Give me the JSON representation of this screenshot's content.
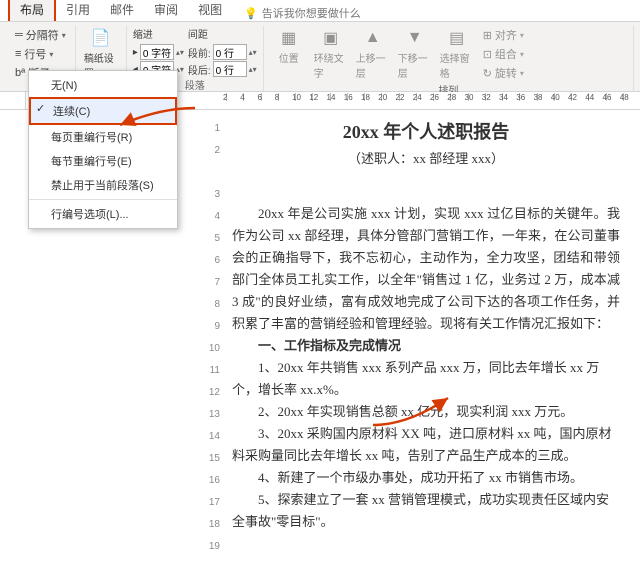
{
  "tabs": {
    "layout": "布局",
    "references": "引用",
    "mailings": "邮件",
    "review": "审阅",
    "view": "视图"
  },
  "tellme": "告诉我你想要做什么",
  "ribbon": {
    "breaks": "分隔符",
    "lineNumbers": "行号",
    "hyphen": "断子",
    "indent": "缩进",
    "spacing": "间距",
    "leftIndent": "0 字符",
    "rightIndent": "0 字符",
    "before": "0 行",
    "after": "0 行",
    "beforeLbl": "段前:",
    "afterLbl": "段后:",
    "paragraph": "段落",
    "position": "位置",
    "wrapText": "环绕文字",
    "bringForward": "上移一层",
    "sendBackward": "下移一层",
    "selectionPane": "选择窗格",
    "align": "对齐",
    "group": "组合",
    "rotate": "旋转",
    "arrange": "排列",
    "paper": "稿纸设置",
    "paperGroup": "稿纸"
  },
  "dropdown": {
    "none": "无(N)",
    "continuous": "连续(C)",
    "restartPage": "每页重编行号(R)",
    "restartSection": "每节重编行号(E)",
    "suppress": "禁止用于当前段落(S)",
    "options": "行编号选项(L)..."
  },
  "ruler": {
    "pageStart": "2"
  },
  "doc": {
    "title": "20xx 年个人述职报告",
    "subtitle": "（述职人：xx 部经理 xxx）",
    "p1": "20xx 年是公司实施 xxx 计划，实现 xxx 过亿目标的关键年。我作为公司 xx 部经理，具体分管部门营销工作，一年来，在公司董事会的正确指导下，我不忘初心，主动作为，全力攻坚，团结和带领部门全体员工扎实工作，以全年\"销售过 1 亿，业务过 2 万，成本减 3 成\"的良好业绩，富有成效地完成了公司下达的各项工作任务，并积累了丰富的营销经验和管理经验。现将有关工作情况汇报如下：",
    "h1": "一、工作指标及完成情况",
    "i1": "1、20xx 年共销售 xxx 系列产品 xxx 万，同比去年增长 xx 万个，增长率 xx.x%。",
    "i2": "2、20xx 年实现销售总额 xx 亿元，现实利润 xxx 万元。",
    "i3": "3、20xx 采购国内原材料 XX 吨，进口原材料 xx 吨，国内原材料采购量同比去年增长 xx 吨，告别了产品生产成本的三成。",
    "i4": "4、新建了一个市级办事处，成功开拓了 xx 市销售市场。",
    "i5": "5、探索建立了一套 xx 营销管理模式，成功实现责任区域内安全事故\"零目标\"。"
  },
  "lineNumbers": [
    1,
    2,
    3,
    4,
    5,
    6,
    7,
    8,
    9,
    10,
    11,
    12,
    13,
    14,
    15,
    16,
    17,
    18,
    19
  ]
}
